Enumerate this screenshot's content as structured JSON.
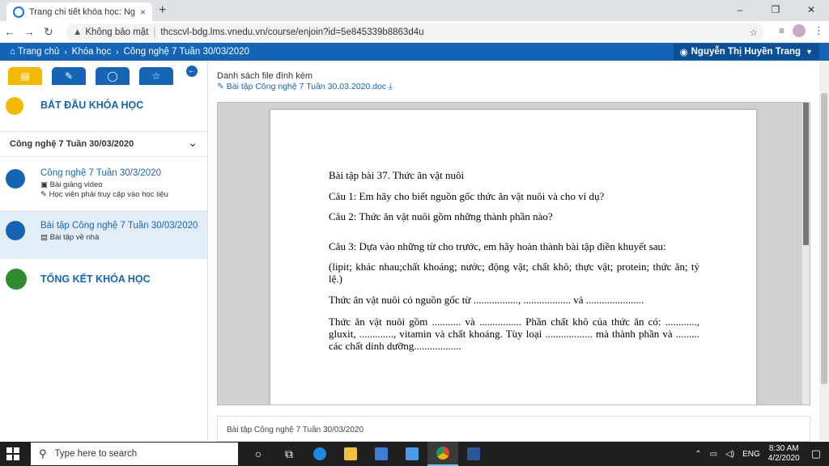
{
  "browser": {
    "tab_title": "Trang chi tiết khóa học: Ngữ văn",
    "tab_close": "×",
    "new_tab": "+",
    "win_min": "–",
    "win_restore": "❐",
    "win_close": "✕",
    "security_label": "Không bảo mật",
    "url": "thcscvl-bdg.lms.vnedu.vn/course/enjoin?id=5e845339b8863d4u"
  },
  "header": {
    "breadcrumb": [
      "Trang chủ",
      "Khóa học",
      "Công nghệ 7 Tuần 30/03/2020"
    ],
    "user_name": "Nguyễn Thị Huyền Trang"
  },
  "sidebar": {
    "start_label": "BẮT ĐẦU KHÓA HỌC",
    "course_title": "Công nghệ 7 Tuần 30/03/2020",
    "lessons": [
      {
        "title": "Công nghệ 7 Tuần 30/3/2020",
        "type": "Bài giảng video",
        "note": "Học viên phải truy cập vào học liệu"
      },
      {
        "title": "Bài tập Công nghệ 7 Tuần 30/03/2020",
        "type": "Bài tập về nhà"
      }
    ],
    "end_label": "TỔNG KẾT KHÓA HỌC",
    "colors": {
      "start": "#f5b800",
      "lesson": "#1565b7",
      "end": "#2e8b2e"
    }
  },
  "main": {
    "attachments_title": "Danh sách file đính kèm",
    "attachment_file": "Bài tập Công nghệ 7 Tuần 30.03.2020.doc",
    "document": {
      "heading": "Bài tập bài 37. Thức ăn vật nuôi",
      "q1": "Câu 1: Em hãy cho biết nguồn gốc thức ăn vật nuôi và cho ví dụ?",
      "q2": "Câu 2: Thức ăn vật nuôi gồm những thành phần nào?",
      "q3": "Câu 3:  Dựa vào những từ cho trước, em hãy hoàn thành bài tập điền khuyết sau:",
      "words": "(lipit; khác nhau;chất khoáng; nước; động vật; chất khô; thực vật; protein; thức ăn; tỷ lệ.)",
      "blank1": "Thức ăn vật nuôi có nguồn gốc  từ ................., .................. và ......................",
      "blank2": "Thức ăn vật nuôi gồm ........... và ................ Phần chất khô của thức ăn có: ............, gluxit, ............., vitamin và chất khoáng. Tùy loại .................. mà thành phần và ......... các chất dinh dưỡng.................."
    },
    "footer_label": "Bài tập Công nghệ 7 Tuần 30/03/2020"
  },
  "taskbar": {
    "search_placeholder": "Type here to search",
    "language": "ENG",
    "time": "8:30 AM",
    "date": "4/2/2020"
  }
}
